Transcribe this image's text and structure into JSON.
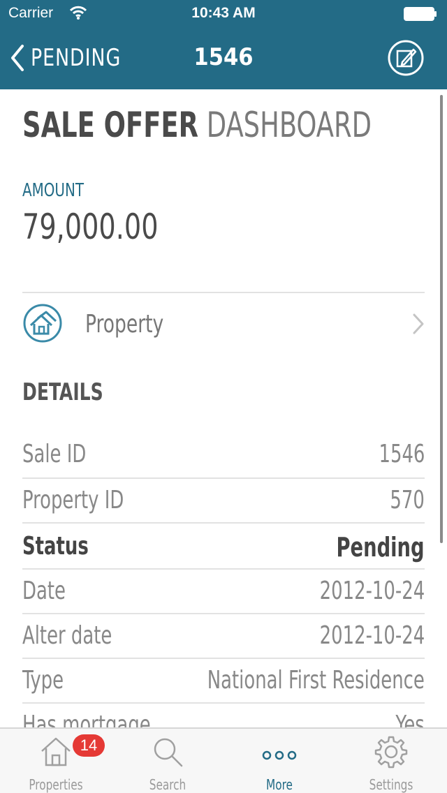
{
  "status_bar": {
    "carrier": "Carrier",
    "time": "10:43 AM"
  },
  "nav": {
    "back_label": "PENDING",
    "title": "1546",
    "edit_icon": "edit-icon"
  },
  "header": {
    "title_bold": "SALE OFFER",
    "title_light": "DASHBOARD"
  },
  "amount": {
    "label": "AMOUNT",
    "value": "79,000.00"
  },
  "property_link": {
    "label": "Property",
    "icon": "house-icon"
  },
  "details": {
    "title": "DETAILS",
    "rows": [
      {
        "key": "Sale ID",
        "value": "1546"
      },
      {
        "key": "Property ID",
        "value": "570"
      },
      {
        "key": "Status",
        "value": "Pending"
      },
      {
        "key": "Date",
        "value": "2012-10-24"
      },
      {
        "key": "Alter date",
        "value": "2012-10-24"
      },
      {
        "key": "Type",
        "value": "National First Residence"
      },
      {
        "key": "Has mortgage",
        "value": "Yes"
      }
    ]
  },
  "tabbar": {
    "tabs": [
      {
        "label": "Properties",
        "icon": "home-icon",
        "badge": "14"
      },
      {
        "label": "Search",
        "icon": "search-icon"
      },
      {
        "label": "More",
        "icon": "more-icon",
        "active": true
      },
      {
        "label": "Settings",
        "icon": "gear-icon"
      }
    ]
  },
  "colors": {
    "accent": "#236b86",
    "badge": "#e53935"
  }
}
